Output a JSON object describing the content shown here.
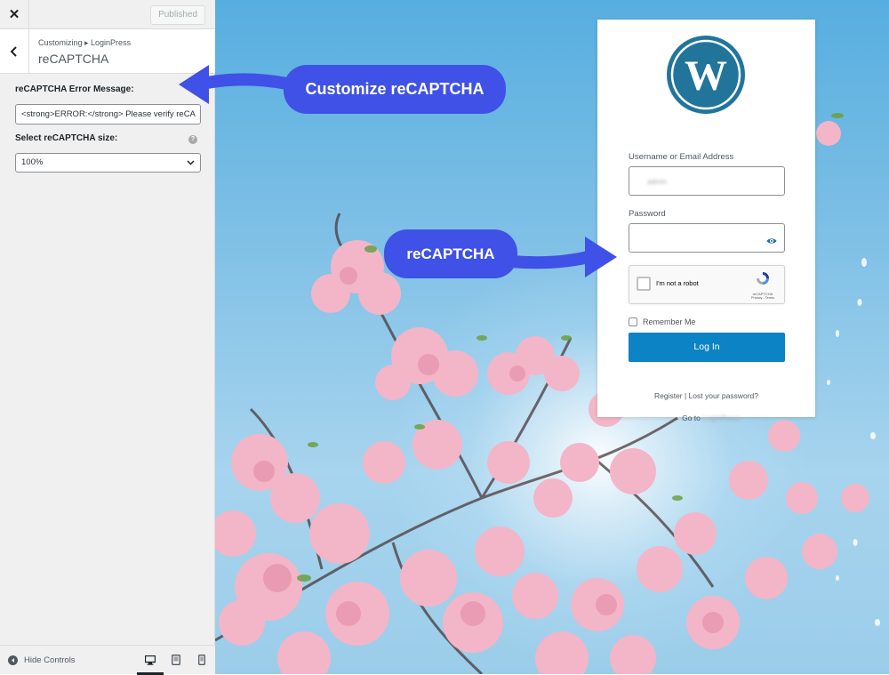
{
  "sidebar": {
    "close_glyph": "✕",
    "publish_label": "Published",
    "breadcrumb": "Customizing ▸ LoginPress",
    "section_title": "reCAPTCHA",
    "error_label": "reCAPTCHA Error Message:",
    "error_value": "<strong>ERROR:</strong> Please verify reCA",
    "size_label": "Select reCAPTCHA size:",
    "help_glyph": "?",
    "size_value": "100%",
    "hide_controls": "Hide Controls"
  },
  "login": {
    "username_label": "Username or Email Address",
    "username_value": "admin",
    "password_label": "Password",
    "captcha_text": "I'm not a robot",
    "captcha_brand": "reCAPTCHA",
    "captcha_links": "Privacy - Terms",
    "remember_label": "Remember Me",
    "login_button": "Log In",
    "links_text": "Register | Lost your password?",
    "goto_prefix": "← Go to",
    "goto_site": "LoginPress"
  },
  "annotations": {
    "customize": "Customize reCAPTCHA",
    "recaptcha": "reCAPTCHA"
  },
  "colors": {
    "accent_blue": "#3f51e6",
    "login_button": "#0b83c4",
    "wp_logo": "#21759b"
  },
  "icons": {
    "close": "close-icon",
    "back": "chevron-left-icon",
    "help": "help-icon",
    "select": "chevron-down-icon",
    "hide": "arrow-left-circle-icon",
    "desktop": "desktop-icon",
    "tablet": "tablet-icon",
    "mobile": "mobile-icon",
    "eye": "eye-icon",
    "recaptcha": "recaptcha-logo-icon"
  }
}
